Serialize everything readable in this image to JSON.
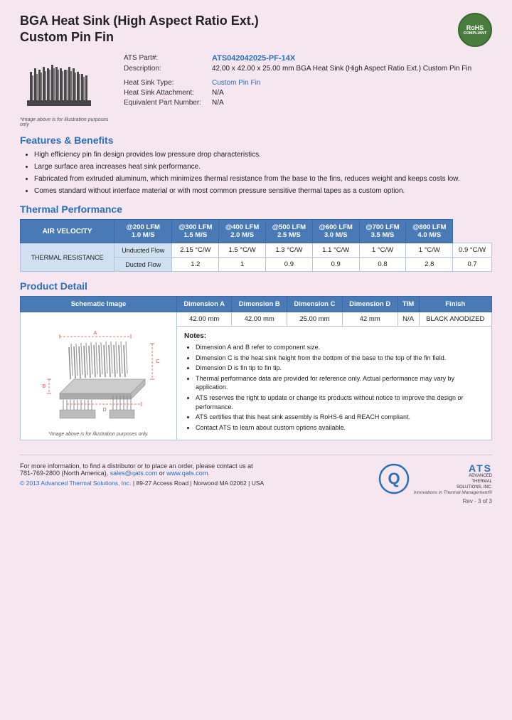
{
  "header": {
    "title_line1": "BGA Heat Sink (High Aspect Ratio Ext.)",
    "title_line2": "Custom Pin Fin",
    "rohs": "RoHS",
    "compliant": "COMPLIANT"
  },
  "product": {
    "part_label": "ATS Part#:",
    "part_number": "ATS042042025-PF-14X",
    "desc_label": "Description:",
    "description": "42.00 x 42.00 x 25.00 mm BGA Heat Sink (High Aspect Ratio Ext.) Custom Pin Fin",
    "type_label": "Heat Sink Type:",
    "type_value": "Custom Pin Fin",
    "attachment_label": "Heat Sink Attachment:",
    "attachment_value": "N/A",
    "equiv_label": "Equivalent Part Number:",
    "equiv_value": "N/A",
    "image_note": "*Image above is for illustration purposes only"
  },
  "features": {
    "title": "Features & Benefits",
    "items": [
      "High efficiency pin fin design provides low pressure drop characteristics.",
      "Large surface area increases heat sink performance.",
      "Fabricated from extruded aluminum, which minimizes thermal resistance from the base to the fins, reduces weight and keeps costs low.",
      "Comes standard without interface material or with most common pressure sensitive thermal tapes as a custom option."
    ]
  },
  "thermal": {
    "title": "Thermal Performance",
    "col_headers": [
      "AIR VELOCITY",
      "@200 LFM\n1.0 M/S",
      "@300 LFM\n1.5 M/S",
      "@400 LFM\n2.0 M/S",
      "@500 LFM\n2.5 M/S",
      "@600 LFM\n3.0 M/S",
      "@700 LFM\n3.5 M/S",
      "@800 LFM\n4.0 M/S"
    ],
    "row_label": "THERMAL RESISTANCE",
    "rows": [
      {
        "label": "Unducted Flow",
        "values": [
          "2.15 °C/W",
          "1.5 °C/W",
          "1.3 °C/W",
          "1.1 °C/W",
          "1 °C/W",
          "1 °C/W",
          "0.9 °C/W"
        ]
      },
      {
        "label": "Ducted Flow",
        "values": [
          "1.2",
          "1",
          "0.9",
          "0.9",
          "0.8",
          "2.8",
          "0.7"
        ]
      }
    ]
  },
  "product_detail": {
    "title": "Product Detail",
    "col_headers": [
      "Schematic Image",
      "Dimension A",
      "Dimension B",
      "Dimension C",
      "Dimension D",
      "TIM",
      "Finish"
    ],
    "dim_a": "42.00 mm",
    "dim_b": "42.00 mm",
    "dim_c": "25.00 mm",
    "dim_d": "42 mm",
    "tim": "N/A",
    "finish": "BLACK ANODIZED",
    "schematic_note": "*Image above is for illustration purposes only.",
    "notes_title": "Notes:",
    "notes": [
      "Dimension A and B refer to component size.",
      "Dimension C is the heat sink height from the bottom of the base to the top of the fin field.",
      "Dimension D is fin tip to fin tip.",
      "Thermal performance data are provided for reference only. Actual performance may vary by application.",
      "ATS reserves the right to update or change its products without notice to improve the design or performance.",
      "ATS certifies that this heat sink assembly is RoHS-6 and REACH compliant.",
      "Contact ATS to learn about custom options available."
    ]
  },
  "footer": {
    "contact_text": "For more information, to find a distributor or to place an order, please contact us at",
    "phone": "781-769-2800 (North America),",
    "email": "sales@qats.com",
    "or": "or",
    "website": "www.qats.com.",
    "copyright": "© 2013 Advanced Thermal Solutions, Inc.",
    "address": "| 89-27 Access Road | Norwood MA  02062 | USA",
    "ats_name": "ATS",
    "ats_full": "ADVANCED\nTHERMAL\nSOLUTIONS, INC.",
    "tagline": "Innovations in Thermal Management®",
    "page_num": "Rev - 3 of 3"
  }
}
